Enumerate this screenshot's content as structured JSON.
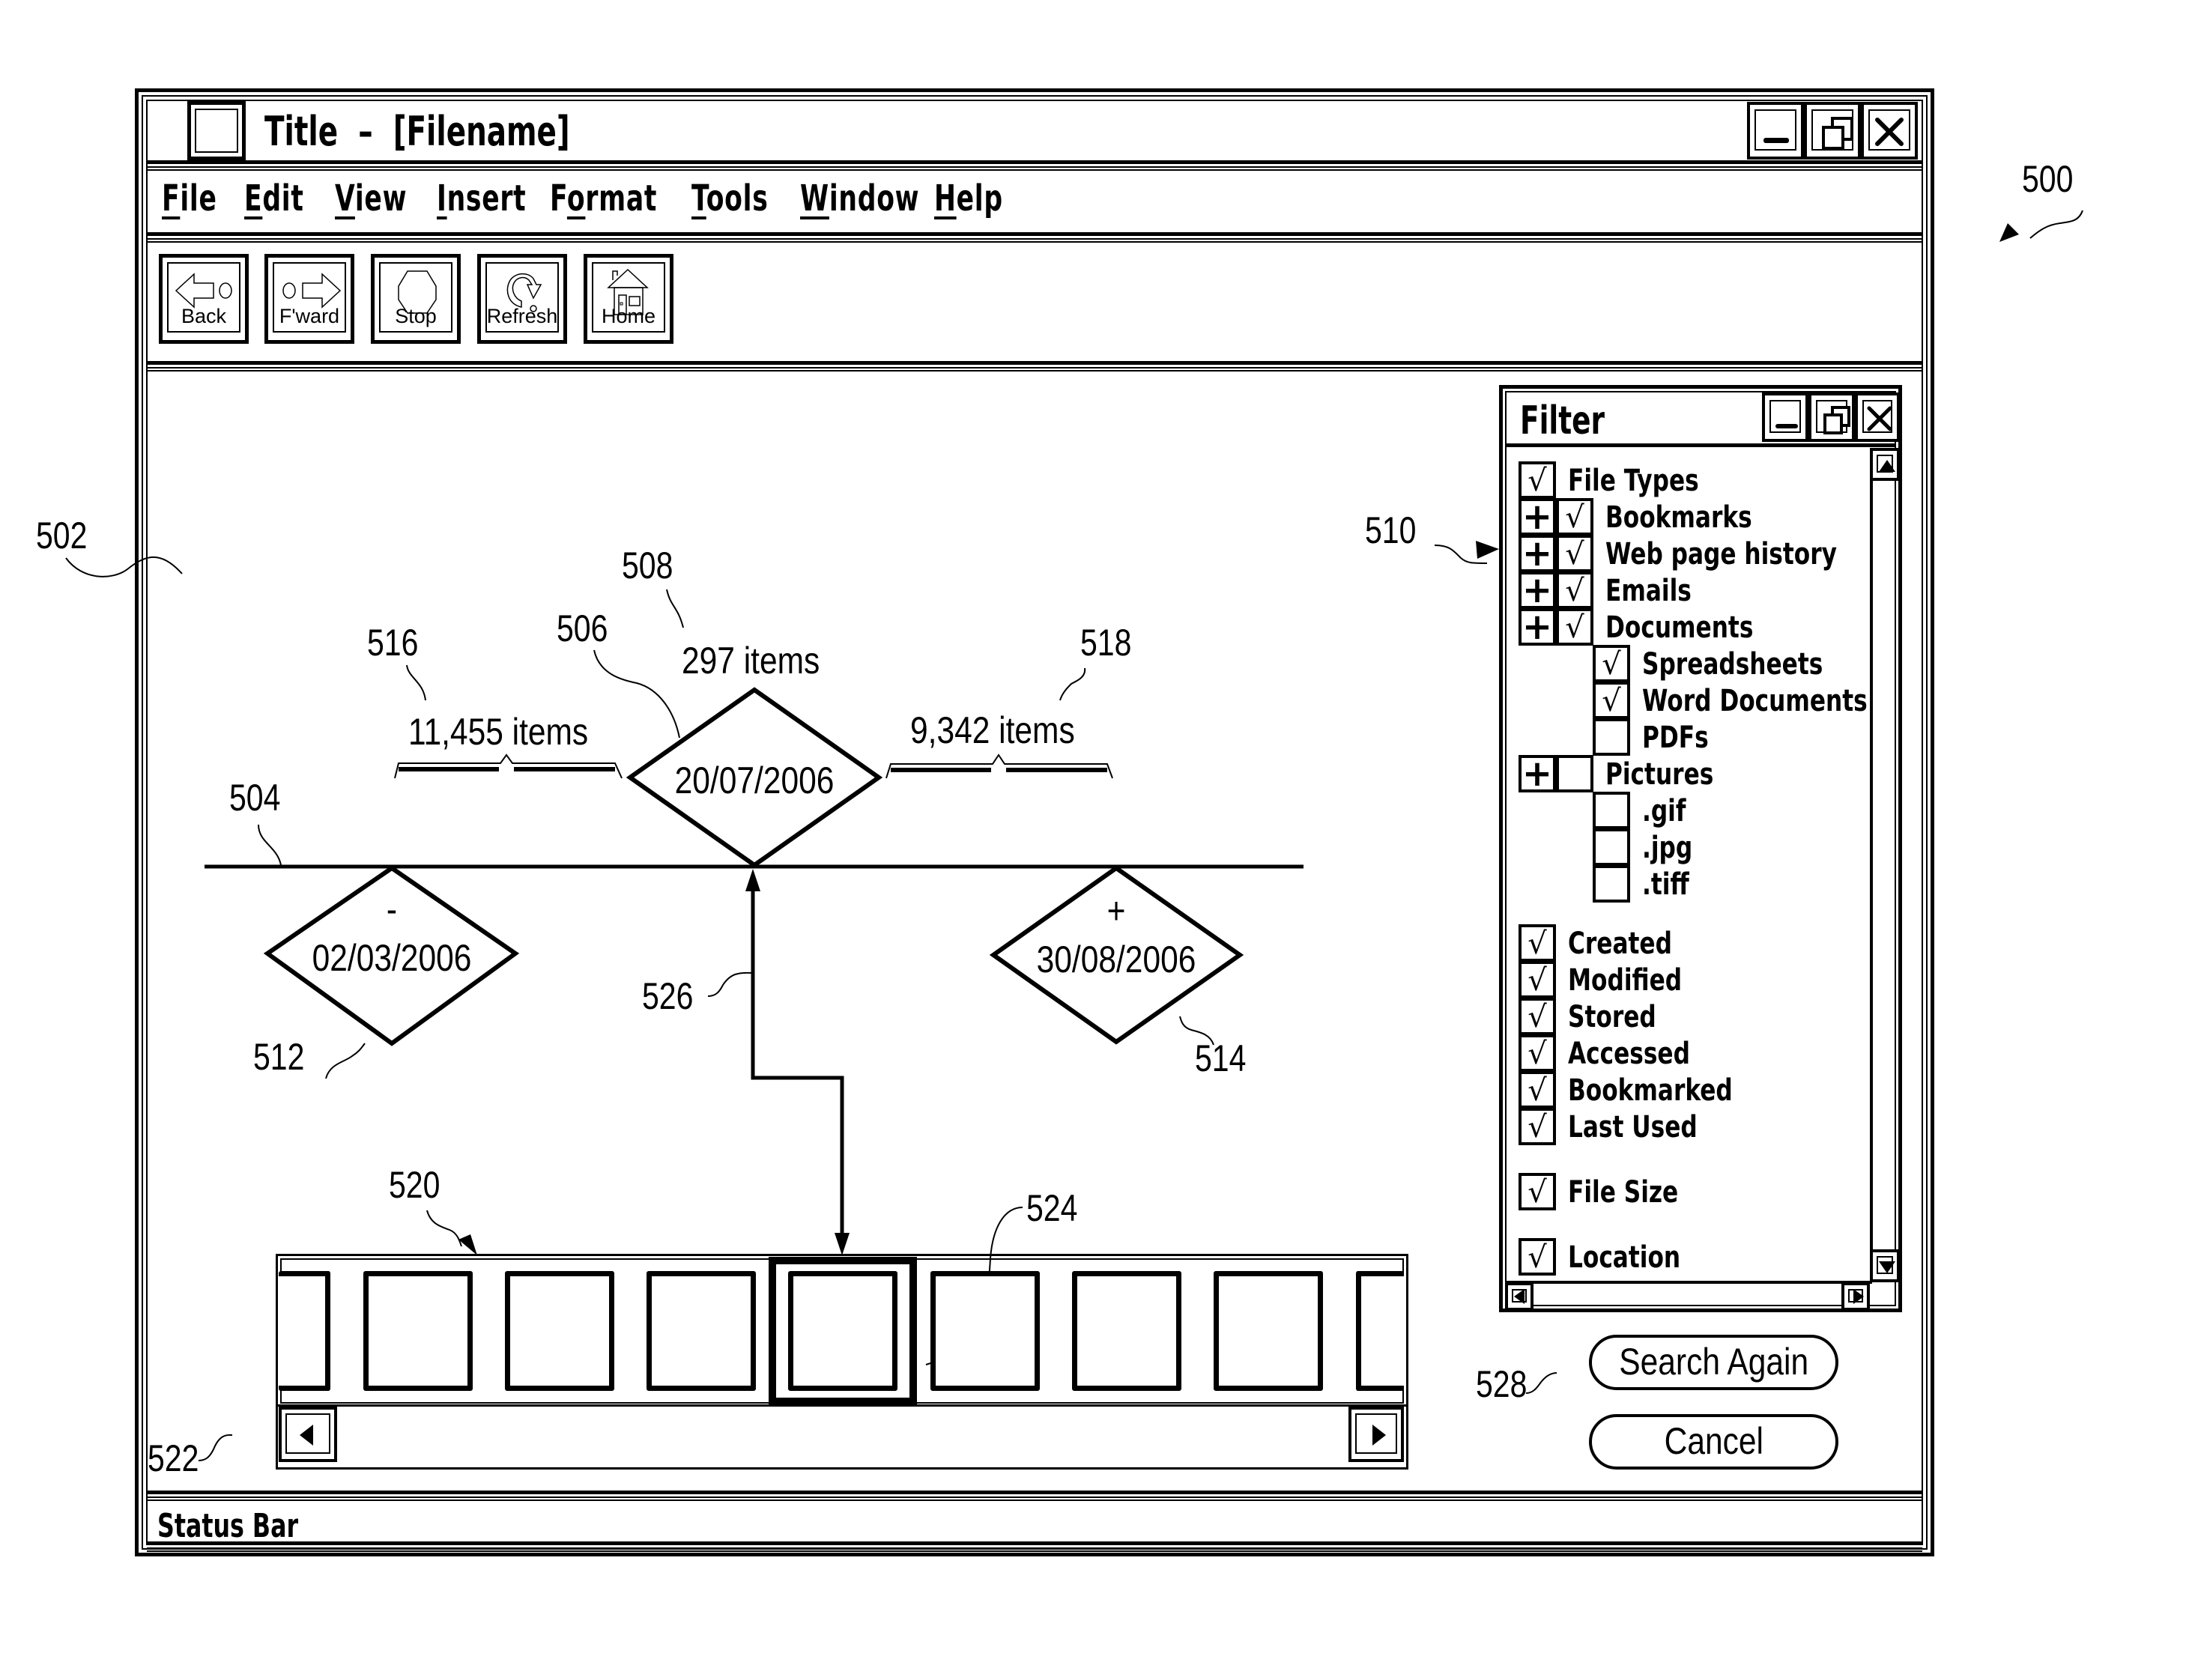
{
  "window": {
    "title": "Title  –  [Filename]",
    "controls": {
      "minimize": "minimize-icon",
      "restore": "restore-icon",
      "close": "close-icon"
    }
  },
  "menu": {
    "items": [
      {
        "label": "File",
        "accel": "F",
        "rest": "ile"
      },
      {
        "label": "Edit",
        "accel": "E",
        "rest": "dit"
      },
      {
        "label": "View",
        "accel": "V",
        "rest": "iew"
      },
      {
        "label": "Insert",
        "accel": "I",
        "rest": "nsert"
      },
      {
        "label": "Format",
        "accel": "F",
        "pre": "F",
        "accel2": "o",
        "rest": "rmat"
      },
      {
        "label": "Tools",
        "accel": "T",
        "rest": "ools"
      },
      {
        "label": "Window",
        "accel": "W",
        "rest": "indow"
      },
      {
        "label": "Help",
        "accel": "H",
        "rest": "elp"
      }
    ]
  },
  "toolbar": {
    "buttons": [
      {
        "label": "Back",
        "icon": "back-arrow-icon"
      },
      {
        "label": "F'ward",
        "icon": "forward-arrow-icon"
      },
      {
        "label": "Stop",
        "icon": "stop-octagon-icon"
      },
      {
        "label": "Refresh",
        "icon": "refresh-icon"
      },
      {
        "label": "Home",
        "icon": "home-icon"
      }
    ]
  },
  "timeline": {
    "current": {
      "date": "20/07/2006",
      "count": "297 items"
    },
    "previous": {
      "date": "02/03/2006",
      "symbol": "-"
    },
    "next": {
      "date": "30/08/2006",
      "symbol": "+"
    },
    "before_count": "11,455 items",
    "after_count": "9,342 items"
  },
  "filmstrip": {
    "frame_count": 8,
    "selected_index": 4,
    "scroll_left": "scroll-left-icon",
    "scroll_right": "scroll-right-icon"
  },
  "filter": {
    "title": "Filter",
    "file_types": [
      {
        "label": "File Types",
        "checked": true,
        "expander": false,
        "level": 0
      },
      {
        "label": "Bookmarks",
        "checked": true,
        "expander": true,
        "level": 1
      },
      {
        "label": "Web page history",
        "checked": true,
        "expander": true,
        "level": 1
      },
      {
        "label": "Emails",
        "checked": true,
        "expander": true,
        "level": 1
      },
      {
        "label": "Documents",
        "checked": true,
        "expander": true,
        "level": 1
      },
      {
        "label": "Spreadsheets",
        "checked": true,
        "expander": false,
        "level": 2
      },
      {
        "label": "Word Documents",
        "checked": true,
        "expander": false,
        "level": 2
      },
      {
        "label": "PDFs",
        "checked": false,
        "expander": false,
        "level": 2
      },
      {
        "label": "Pictures",
        "checked": false,
        "expander": true,
        "level": 1
      },
      {
        "label": ".gif",
        "checked": false,
        "expander": false,
        "level": 2
      },
      {
        "label": ".jpg",
        "checked": false,
        "expander": false,
        "level": 2
      },
      {
        "label": ".tiff",
        "checked": false,
        "expander": false,
        "level": 2
      }
    ],
    "date_options": [
      {
        "label": "Created",
        "checked": true
      },
      {
        "label": "Modified",
        "checked": true
      },
      {
        "label": "Stored",
        "checked": true
      },
      {
        "label": "Accessed",
        "checked": true
      },
      {
        "label": "Bookmarked",
        "checked": true
      },
      {
        "label": "Last Used",
        "checked": true
      }
    ],
    "file_size": {
      "label": "File Size",
      "checked": true
    },
    "location": {
      "label": "Location",
      "checked": true
    },
    "check_glyph": "√",
    "plus_glyph": "+"
  },
  "buttons": {
    "search_again": "Search Again",
    "cancel": "Cancel"
  },
  "status_bar": {
    "text": "Status Bar"
  },
  "reference_labels": {
    "r500": "500",
    "r502": "502",
    "r504": "504",
    "r506": "506",
    "r508": "508",
    "r510": "510",
    "r512": "512",
    "r514": "514",
    "r516": "516",
    "r518": "518",
    "r520": "520",
    "r522": "522",
    "r524": "524",
    "r526": "526",
    "r528": "528"
  }
}
